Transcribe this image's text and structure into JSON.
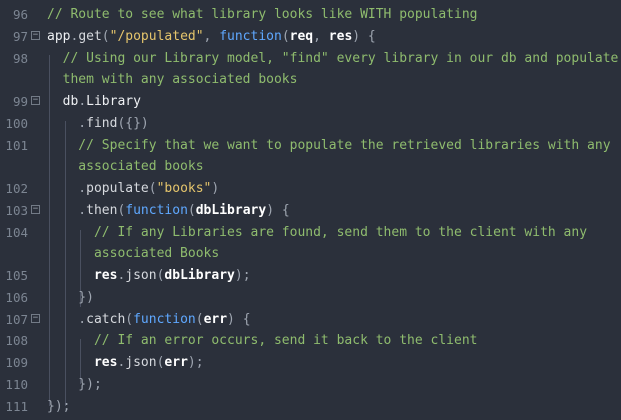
{
  "editor": {
    "lines": [
      {
        "n": "96",
        "fold": false,
        "code": [
          {
            "t": "// Route to see what library looks like WITH populating",
            "c": "c"
          }
        ]
      },
      {
        "n": "97",
        "fold": true,
        "code": [
          {
            "t": "app",
            "c": "b"
          },
          {
            "t": ".",
            "c": "u"
          },
          {
            "t": "get",
            "c": "f"
          },
          {
            "t": "(",
            "c": "u"
          },
          {
            "t": "\"/populated\"",
            "c": "s"
          },
          {
            "t": ", ",
            "c": "u"
          },
          {
            "t": "function",
            "c": "kw"
          },
          {
            "t": "(",
            "c": "u"
          },
          {
            "t": "req",
            "c": "p"
          },
          {
            "t": ", ",
            "c": "u"
          },
          {
            "t": "res",
            "c": "p"
          },
          {
            "t": ") {",
            "c": "u"
          }
        ]
      },
      {
        "n": "98",
        "fold": false,
        "code": [
          {
            "t": "  // Using our Library model, \"find\" every library in our db and populate",
            "c": "c"
          }
        ]
      },
      {
        "n": "",
        "fold": false,
        "code": [
          {
            "t": "  them with any associated books",
            "c": "c"
          }
        ]
      },
      {
        "n": "99",
        "fold": true,
        "code": [
          {
            "t": "  db",
            "c": "b"
          },
          {
            "t": ".",
            "c": "u"
          },
          {
            "t": "Library",
            "c": "b"
          }
        ]
      },
      {
        "n": "100",
        "fold": false,
        "code": [
          {
            "t": "    .",
            "c": "u"
          },
          {
            "t": "find",
            "c": "f"
          },
          {
            "t": "({})",
            "c": "u"
          }
        ]
      },
      {
        "n": "101",
        "fold": false,
        "code": [
          {
            "t": "    // Specify that we want to populate the retrieved libraries with any",
            "c": "c"
          }
        ]
      },
      {
        "n": "",
        "fold": false,
        "code": [
          {
            "t": "    associated books",
            "c": "c"
          }
        ]
      },
      {
        "n": "102",
        "fold": false,
        "code": [
          {
            "t": "    .",
            "c": "u"
          },
          {
            "t": "populate",
            "c": "f"
          },
          {
            "t": "(",
            "c": "u"
          },
          {
            "t": "\"books\"",
            "c": "s"
          },
          {
            "t": ")",
            "c": "u"
          }
        ]
      },
      {
        "n": "103",
        "fold": true,
        "code": [
          {
            "t": "    .",
            "c": "u"
          },
          {
            "t": "then",
            "c": "f"
          },
          {
            "t": "(",
            "c": "u"
          },
          {
            "t": "function",
            "c": "kw"
          },
          {
            "t": "(",
            "c": "u"
          },
          {
            "t": "dbLibrary",
            "c": "p"
          },
          {
            "t": ") {",
            "c": "u"
          }
        ]
      },
      {
        "n": "104",
        "fold": false,
        "code": [
          {
            "t": "      // If any Libraries are found, send them to the client with any",
            "c": "c"
          }
        ]
      },
      {
        "n": "",
        "fold": false,
        "code": [
          {
            "t": "      associated Books",
            "c": "c"
          }
        ]
      },
      {
        "n": "105",
        "fold": false,
        "code": [
          {
            "t": "      res",
            "c": "p"
          },
          {
            "t": ".",
            "c": "u"
          },
          {
            "t": "json",
            "c": "f"
          },
          {
            "t": "(",
            "c": "u"
          },
          {
            "t": "dbLibrary",
            "c": "p"
          },
          {
            "t": ");",
            "c": "u"
          }
        ]
      },
      {
        "n": "106",
        "fold": false,
        "code": [
          {
            "t": "    })",
            "c": "u"
          }
        ]
      },
      {
        "n": "107",
        "fold": true,
        "code": [
          {
            "t": "    .",
            "c": "u"
          },
          {
            "t": "catch",
            "c": "f"
          },
          {
            "t": "(",
            "c": "u"
          },
          {
            "t": "function",
            "c": "kw"
          },
          {
            "t": "(",
            "c": "u"
          },
          {
            "t": "err",
            "c": "p"
          },
          {
            "t": ") {",
            "c": "u"
          }
        ]
      },
      {
        "n": "108",
        "fold": false,
        "code": [
          {
            "t": "      // If an error occurs, send it back to the client",
            "c": "c"
          }
        ]
      },
      {
        "n": "109",
        "fold": false,
        "code": [
          {
            "t": "      res",
            "c": "p"
          },
          {
            "t": ".",
            "c": "u"
          },
          {
            "t": "json",
            "c": "f"
          },
          {
            "t": "(",
            "c": "u"
          },
          {
            "t": "err",
            "c": "p"
          },
          {
            "t": ");",
            "c": "u"
          }
        ]
      },
      {
        "n": "110",
        "fold": false,
        "code": [
          {
            "t": "    });",
            "c": "u"
          }
        ]
      },
      {
        "n": "111",
        "fold": false,
        "code": [
          {
            "t": "});",
            "c": "u"
          }
        ]
      }
    ]
  },
  "colors": {
    "background": "#2b303b",
    "comment": "#8fbc6e",
    "string": "#e5c56c",
    "keyword": "#5fa8ff",
    "param": "#ffffff",
    "line_number": "#7c8592"
  },
  "icons": {
    "fold": "fold-minus-icon"
  }
}
